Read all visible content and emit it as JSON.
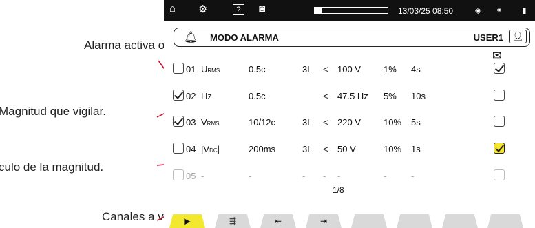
{
  "callouts": {
    "active": "Alarma activa o no.",
    "magnitude": "Magnitud que vigilar.",
    "calc": "culo de la magnitud.",
    "channels": "Canales a vigilar."
  },
  "topbar": {
    "icons": [
      "home-icon",
      "settings-icon",
      "help-icon",
      "camera-icon"
    ],
    "help_label": "?",
    "datetime": "13/03/25 08:50",
    "progress": 0.09
  },
  "header": {
    "title": "MODO ALARMA",
    "user": "USER1"
  },
  "rows": [
    {
      "id": "01",
      "quantity": "U",
      "sub": "RMS",
      "calc": "0.5c",
      "channels": "3L",
      "op": "<",
      "threshold": "100 V",
      "hyst": "1%",
      "duration": "4s",
      "active": false,
      "mail": true,
      "disabled": false
    },
    {
      "id": "02",
      "quantity": "Hz",
      "sub": "",
      "calc": "0.5c",
      "channels": "",
      "op": "<",
      "threshold": "47.5 Hz",
      "hyst": "5%",
      "duration": "10s",
      "active": true,
      "mail": false,
      "disabled": false
    },
    {
      "id": "03",
      "quantity": "V",
      "sub": "RMS",
      "calc": "10/12c",
      "channels": "3L",
      "op": "<",
      "threshold": "220 V",
      "hyst": "10%",
      "duration": "5s",
      "active": true,
      "mail": false,
      "disabled": false
    },
    {
      "id": "04",
      "quantity": "|V",
      "sub": "DC",
      "quantity_suffix": "|",
      "calc": "200ms",
      "channels": "3L",
      "op": "<",
      "threshold": "50 V",
      "hyst": "10%",
      "duration": "1s",
      "active": false,
      "mail": true,
      "disabled": false
    },
    {
      "id": "05",
      "quantity": "-",
      "sub": "",
      "calc": "-",
      "channels": "-",
      "op": "-",
      "threshold": "-",
      "hyst": "-",
      "duration": "-",
      "active": false,
      "mail": false,
      "disabled": true
    }
  ],
  "page": "1/8",
  "function_keys": [
    "play-icon",
    "sequence-play-icon",
    "import-icon",
    "export-icon",
    "",
    "",
    "",
    ""
  ]
}
